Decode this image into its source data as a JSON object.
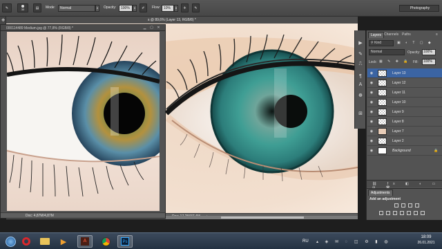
{
  "options_bar": {
    "brush_size": "30",
    "mode_label": "Mode:",
    "mode_value": "Normal",
    "opacity_label": "Opacity:",
    "opacity_value": "100%",
    "flow_label": "Flow:",
    "flow_value": "10%",
    "workspace": "Photography"
  },
  "main_document": {
    "tab_title": "s @ 89,6% (Layer 13, RGB/8) *",
    "status": "Doc: 17,2M/37,4M"
  },
  "floating_document": {
    "title": "000114489 Medium.jpg @ 77,8% (RGB/8) *",
    "status": "Doc: 4,87M/4,87M"
  },
  "layers_panel": {
    "tabs": [
      "Layers",
      "Channels",
      "Paths"
    ],
    "filter_kind": "Kind",
    "blend_mode": "Normal",
    "opacity_label": "Opacity:",
    "opacity_value": "100%",
    "lock_label": "Lock:",
    "fill_label": "Fill:",
    "fill_value": "100%",
    "layers": [
      {
        "name": "Layer 13",
        "selected": true,
        "thumb": "transparent"
      },
      {
        "name": "Layer 12",
        "selected": false,
        "thumb": "transparent"
      },
      {
        "name": "Layer 11",
        "selected": false,
        "thumb": "transparent"
      },
      {
        "name": "Layer 10",
        "selected": false,
        "thumb": "transparent"
      },
      {
        "name": "Layer 9",
        "selected": false,
        "thumb": "transparent"
      },
      {
        "name": "Layer 8",
        "selected": false,
        "thumb": "transparent"
      },
      {
        "name": "Layer 7",
        "selected": false,
        "thumb": "eye-sketch"
      },
      {
        "name": "Layer 2",
        "selected": false,
        "thumb": "transparent"
      },
      {
        "name": "Background",
        "selected": false,
        "thumb": "white"
      }
    ]
  },
  "adjustments_panel": {
    "tab": "Adjustments",
    "heading": "Add an adjustment"
  },
  "taskbar": {
    "apps": [
      "start-orb",
      "opera",
      "file-explorer",
      "media-player",
      "acrobat",
      "chrome",
      "photoshop"
    ],
    "language": "RU",
    "time": "18:09",
    "date": "26.01.2021"
  }
}
